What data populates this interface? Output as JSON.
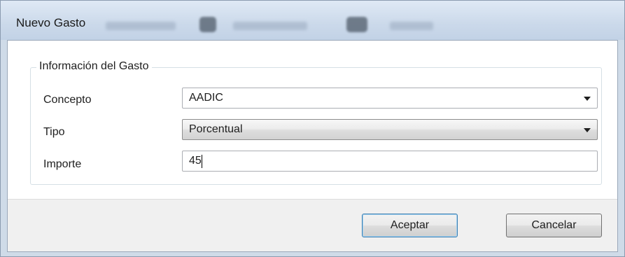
{
  "window": {
    "title": "Nuevo Gasto"
  },
  "group": {
    "legend": "Información del Gasto"
  },
  "fields": {
    "concepto": {
      "label": "Concepto",
      "value": "AADIC"
    },
    "tipo": {
      "label": "Tipo",
      "value": "Porcentual"
    },
    "importe": {
      "label": "Importe",
      "value": "45"
    }
  },
  "buttons": {
    "accept_label": "Aceptar",
    "cancel_label": "Cancelar"
  },
  "icons": {
    "combo_arrow": "chevron-down-icon"
  },
  "colors": {
    "frame": "#cfdbe8",
    "client": "#f0f0f0",
    "default_button_border": "#3c7fb1"
  }
}
